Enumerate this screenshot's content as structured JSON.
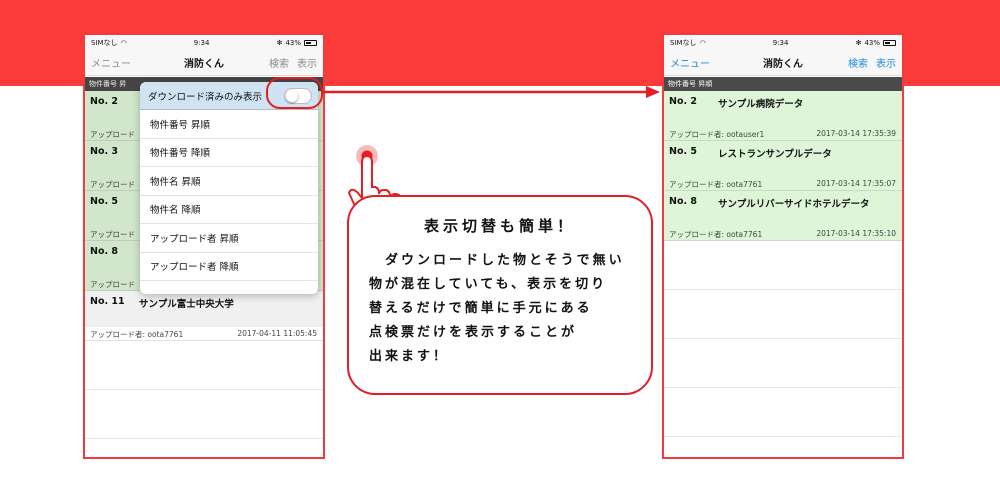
{
  "status": {
    "carrier": "SIMなし",
    "time": "9:34",
    "battery": "43%"
  },
  "nav": {
    "menu": "メニュー",
    "title": "消防くん",
    "search": "検索",
    "display": "表示"
  },
  "left_section_header": "物件番号 昇",
  "right_section_header": "物件番号 昇順",
  "popover": {
    "header_label": "ダウンロード済みのみ表示",
    "options": [
      "物件番号 昇順",
      "物件番号 降順",
      "物件名 昇順",
      "物件名 降順",
      "アップロード者 昇順",
      "アップロード者 降順"
    ]
  },
  "left_rows": [
    {
      "no": "No. 2",
      "uploader": "アップロード",
      "date_fragment": "9"
    },
    {
      "no": "No. 3",
      "uploader": "アップロード",
      "date_fragment": "3"
    },
    {
      "no": "No. 5",
      "uploader": "アップロード",
      "date_fragment": "7"
    },
    {
      "no": "No. 8",
      "uploader": "アップロード",
      "date_fragment": "0"
    },
    {
      "no": "No. 11",
      "name": "サンプル富士中央大学",
      "uploader": "アップロード者: oota7761",
      "date": "2017-04-11 11:05:45"
    }
  ],
  "right_rows": [
    {
      "no": "No. 2",
      "name": "サンプル病院データ",
      "uploader": "アップロード者: ootauser1",
      "date": "2017-03-14 17:35:39"
    },
    {
      "no": "No. 5",
      "name": "レストランサンプルデータ",
      "uploader": "アップロード者: oota7761",
      "date": "2017-03-14 17:35:07"
    },
    {
      "no": "No. 8",
      "name": "サンプルリバーサイドホテルデータ",
      "uploader": "アップロード者: oota7761",
      "date": "2017-03-14 17:35:10"
    }
  ],
  "callout": {
    "title": "表示切替も簡単！",
    "lines": [
      "　ダウンロードした物とそうで無い",
      "物が混在していても、表示を切り",
      "替えるだけで簡単に手元にある",
      "点検票だけを表示することが",
      "出来ます！"
    ]
  },
  "colors": {
    "band": "#fb3a3a",
    "accent_red": "#e31e24",
    "row_green": "#dff5d8",
    "nav_blue": "#1e88e5",
    "header_gray": "#4a4a4a"
  }
}
